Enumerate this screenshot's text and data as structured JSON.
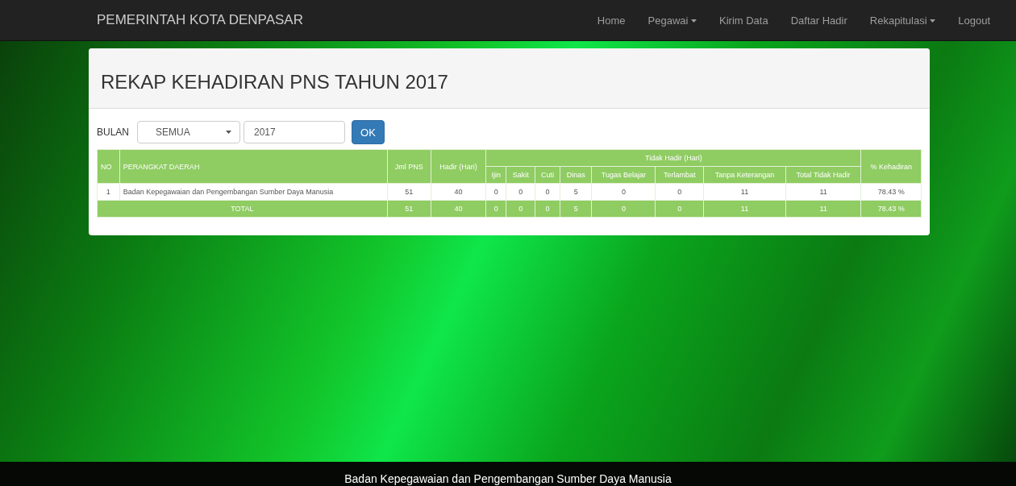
{
  "navbar": {
    "brand": "PEMERINTAH KOTA DENPASAR",
    "items": [
      {
        "label": "Home",
        "dropdown": false
      },
      {
        "label": "Pegawai",
        "dropdown": true
      },
      {
        "label": "Kirim Data",
        "dropdown": false
      },
      {
        "label": "Daftar Hadir",
        "dropdown": false
      },
      {
        "label": "Rekapitulasi",
        "dropdown": true
      },
      {
        "label": "Logout",
        "dropdown": false
      }
    ]
  },
  "panel": {
    "title": "REKAP KEHADIRAN PNS TAHUN 2017",
    "filter": {
      "label": "BULAN",
      "month": "SEMUA",
      "year": "2017",
      "button": "OK"
    },
    "table": {
      "columns": [
        "NO",
        "PERANGKAT DAERAH",
        "Jml PNS",
        "Hadir (Hari)"
      ],
      "group": "Tidak Hadir (Hari)",
      "last": "% Kehadiran",
      "subcolumns": [
        "Ijin",
        "Sakit",
        "Cuti",
        "Dinas",
        "Tugas Belajar",
        "Terlambat",
        "Tanpa Keterangan",
        "Total Tidak Hadir"
      ],
      "rows": [
        {
          "kind": "data",
          "cells": [
            "1",
            "Badan Kepegawaian dan Pengembangan Sumber Daya Manusia",
            "51",
            "40",
            "0",
            "0",
            "0",
            "5",
            "0",
            "0",
            "11",
            "11",
            "78.43 %"
          ]
        },
        {
          "kind": "total",
          "cells": [
            {
              "text": "TOTAL",
              "colspan": 2
            },
            "51",
            "40",
            "0",
            "0",
            "0",
            "5",
            "0",
            "0",
            "11",
            "11",
            "78.43 %"
          ]
        }
      ]
    }
  },
  "footer": {
    "text": "Badan Kepegawaian dan Pengembangan Sumber Daya Manusia"
  }
}
